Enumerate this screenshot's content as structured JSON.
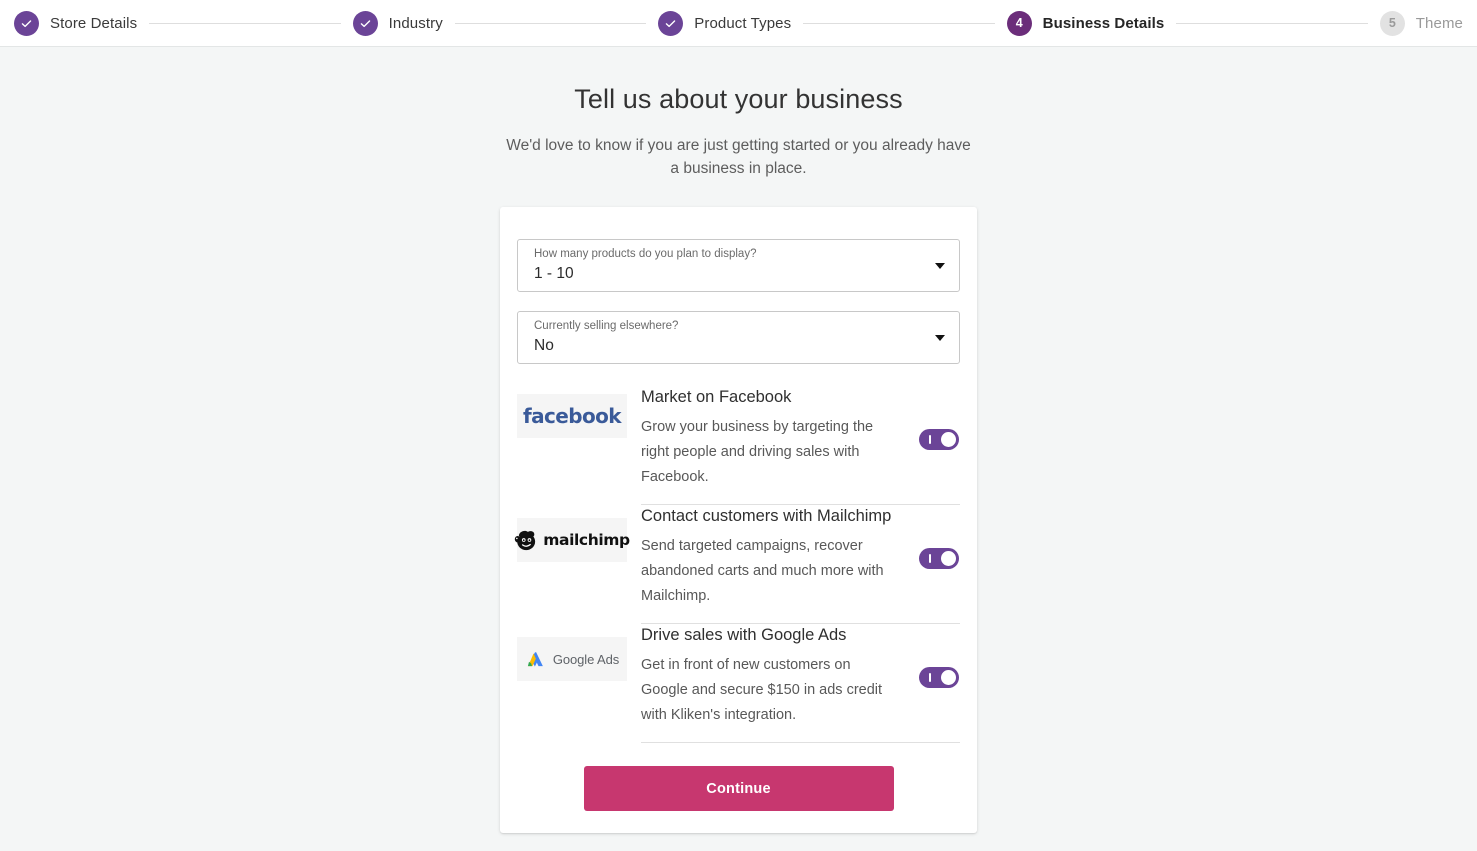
{
  "stepper": {
    "steps": [
      {
        "label": "Store Details",
        "state": "done",
        "marker": "check-icon"
      },
      {
        "label": "Industry",
        "state": "done",
        "marker": "check-icon"
      },
      {
        "label": "Product Types",
        "state": "done",
        "marker": "check-icon"
      },
      {
        "label": "Business Details",
        "state": "current",
        "marker": "4"
      },
      {
        "label": "Theme",
        "state": "pending",
        "marker": "5"
      }
    ]
  },
  "header": {
    "title": "Tell us about your business",
    "subtitle": "We'd love to know if you are just getting started or you already have a business in place."
  },
  "form": {
    "fields": [
      {
        "label": "How many products do you plan to display?",
        "value": "1 - 10"
      },
      {
        "label": "Currently selling elsewhere?",
        "value": "No"
      }
    ]
  },
  "integrations": [
    {
      "logo": "facebook-logo",
      "logo_text": "facebook",
      "title": "Market on Facebook",
      "description": "Grow your business by targeting the right people and driving sales with Facebook.",
      "toggle_on": true
    },
    {
      "logo": "mailchimp-logo",
      "logo_text": "mailchimp",
      "title": "Contact customers with Mailchimp",
      "description": "Send targeted campaigns, recover abandoned carts and much more with Mailchimp.",
      "toggle_on": true
    },
    {
      "logo": "google-ads-logo",
      "logo_text": "Google Ads",
      "title": "Drive sales with Google Ads",
      "description": "Get in front of new customers on Google and secure $150 in ads credit with Kliken's integration.",
      "toggle_on": true
    }
  ],
  "footer": {
    "continue_label": "Continue"
  },
  "colors": {
    "step_done": "#6b4497",
    "step_current": "#6b2d7a",
    "step_pending": "#e2e2e2",
    "toggle_on": "#6b4497",
    "continue_button": "#c7376f",
    "page_background": "#f4f6f6",
    "card_background": "#ffffff"
  }
}
